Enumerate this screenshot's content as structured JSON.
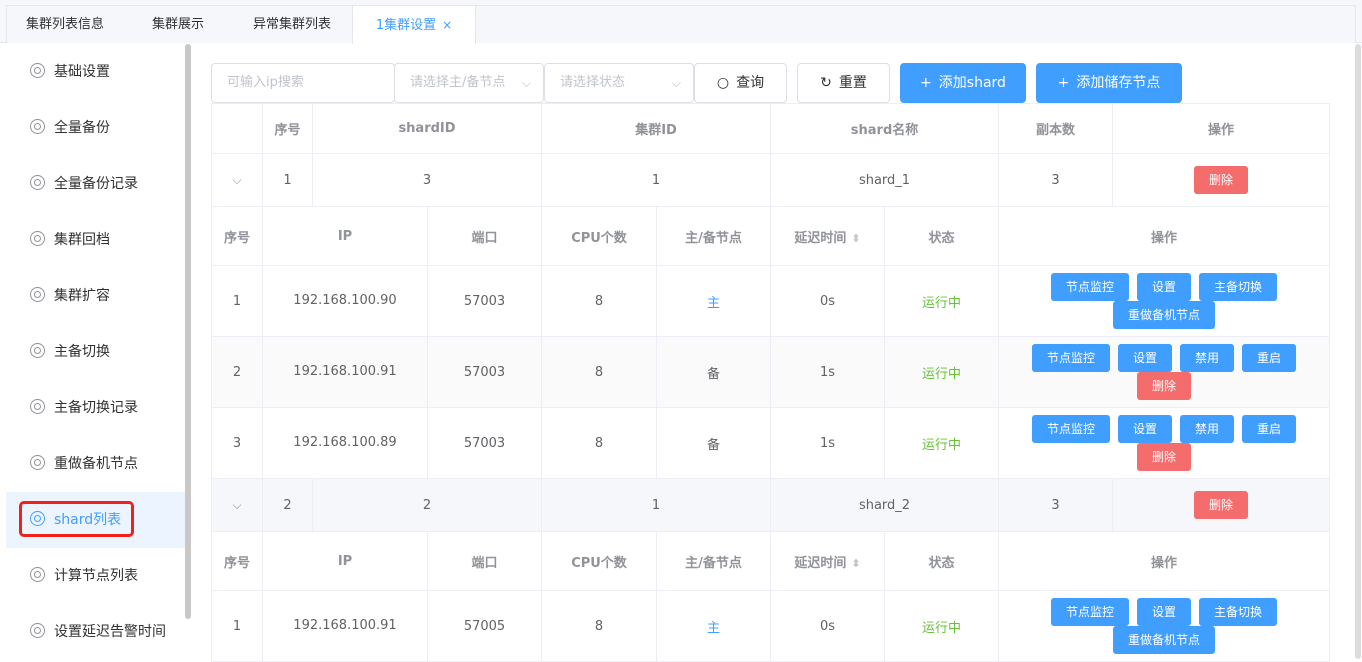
{
  "tabs": [
    {
      "label": "集群列表信息"
    },
    {
      "label": "集群展示"
    },
    {
      "label": "异常集群列表"
    },
    {
      "label": "1集群设置",
      "close": "×"
    }
  ],
  "sidebar": {
    "items": [
      {
        "label": "基础设置"
      },
      {
        "label": "全量备份"
      },
      {
        "label": "全量备份记录"
      },
      {
        "label": "集群回档"
      },
      {
        "label": "集群扩容"
      },
      {
        "label": "主备切换"
      },
      {
        "label": "主备切换记录"
      },
      {
        "label": "重做备机节点"
      },
      {
        "label": "shard列表"
      },
      {
        "label": "计算节点列表"
      },
      {
        "label": "设置延迟告警时间"
      }
    ],
    "active_index": 8
  },
  "toolbar": {
    "ip_placeholder": "可输入ip搜索",
    "role_placeholder": "请选择主/备节点",
    "status_placeholder": "请选择状态",
    "query_label": "查询",
    "reset_label": "重置",
    "add_shard_label": "添加shard",
    "add_storage_label": "添加储存节点"
  },
  "shard_table": {
    "headers": [
      "",
      "序号",
      "shardID",
      "集群ID",
      "shard名称",
      "副本数",
      "操作"
    ],
    "delete_label": "删除",
    "expand_icon": "chevron-down-icon",
    "shards": [
      {
        "index": "1",
        "shard_id": "3",
        "cluster_id": "1",
        "name": "shard_1",
        "replicas": "3",
        "nodes": [
          {
            "index": "1",
            "ip": "192.168.100.90",
            "port": "57003",
            "cpu": "8",
            "role": "主",
            "delay": "0s",
            "status": "运行中",
            "actions": [
              "节点监控",
              "设置",
              "主备切换",
              "重做备机节点"
            ]
          },
          {
            "index": "2",
            "ip": "192.168.100.91",
            "port": "57003",
            "cpu": "8",
            "role": "备",
            "delay": "1s",
            "status": "运行中",
            "actions": [
              "节点监控",
              "设置",
              "禁用",
              "重启",
              "删除"
            ]
          },
          {
            "index": "3",
            "ip": "192.168.100.89",
            "port": "57003",
            "cpu": "8",
            "role": "备",
            "delay": "1s",
            "status": "运行中",
            "actions": [
              "节点监控",
              "设置",
              "禁用",
              "重启",
              "删除"
            ]
          }
        ]
      },
      {
        "index": "2",
        "shard_id": "2",
        "cluster_id": "1",
        "name": "shard_2",
        "replicas": "3",
        "nodes": [
          {
            "index": "1",
            "ip": "192.168.100.91",
            "port": "57005",
            "cpu": "8",
            "role": "主",
            "delay": "0s",
            "status": "运行中",
            "actions": [
              "节点监控",
              "设置",
              "主备切换",
              "重做备机节点"
            ]
          }
        ]
      }
    ]
  },
  "node_table": {
    "headers": [
      "序号",
      "IP",
      "端口",
      "CPU个数",
      "主/备节点",
      "延迟时间",
      "状态",
      "操作"
    ]
  },
  "colors": {
    "primary": "#409eff",
    "danger": "#f56c6c",
    "success": "#67c23a",
    "highlight": "#f0201a"
  }
}
